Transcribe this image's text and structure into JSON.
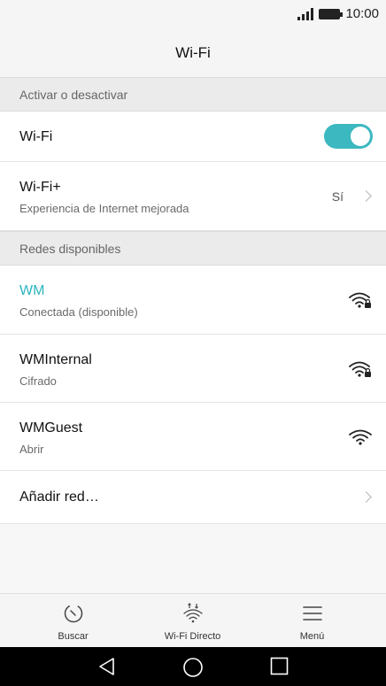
{
  "status": {
    "time": "10:00"
  },
  "header": {
    "title": "Wi-Fi"
  },
  "sections": {
    "toggle_header": "Activar o desactivar",
    "networks_header": "Redes disponibles"
  },
  "wifi_row": {
    "label": "Wi-Fi",
    "enabled": true
  },
  "wifi_plus": {
    "label": "Wi-Fi+",
    "subtitle": "Experiencia de Internet mejorada",
    "value": "Sí"
  },
  "networks": [
    {
      "name": "WM",
      "status": "Conectada  (disponible)",
      "secured": true,
      "connected": true,
      "icon": "wifi-lock-icon"
    },
    {
      "name": "WMInternal",
      "status": "Cifrado",
      "secured": true,
      "connected": false,
      "icon": "wifi-lock-icon"
    },
    {
      "name": "WMGuest",
      "status": "Abrir",
      "secured": false,
      "connected": false,
      "icon": "wifi-icon"
    }
  ],
  "add_network": {
    "label": "Añadir red…"
  },
  "bottom_tabs": {
    "scan": {
      "label": "Buscar",
      "icon": "refresh-icon"
    },
    "direct": {
      "label": "Wi-Fi Directo",
      "icon": "wifi-direct-icon"
    },
    "menu": {
      "label": "Menú",
      "icon": "menu-icon"
    }
  },
  "colors": {
    "accent": "#2cb5bf",
    "toggle_on": "#3cb8c0"
  }
}
